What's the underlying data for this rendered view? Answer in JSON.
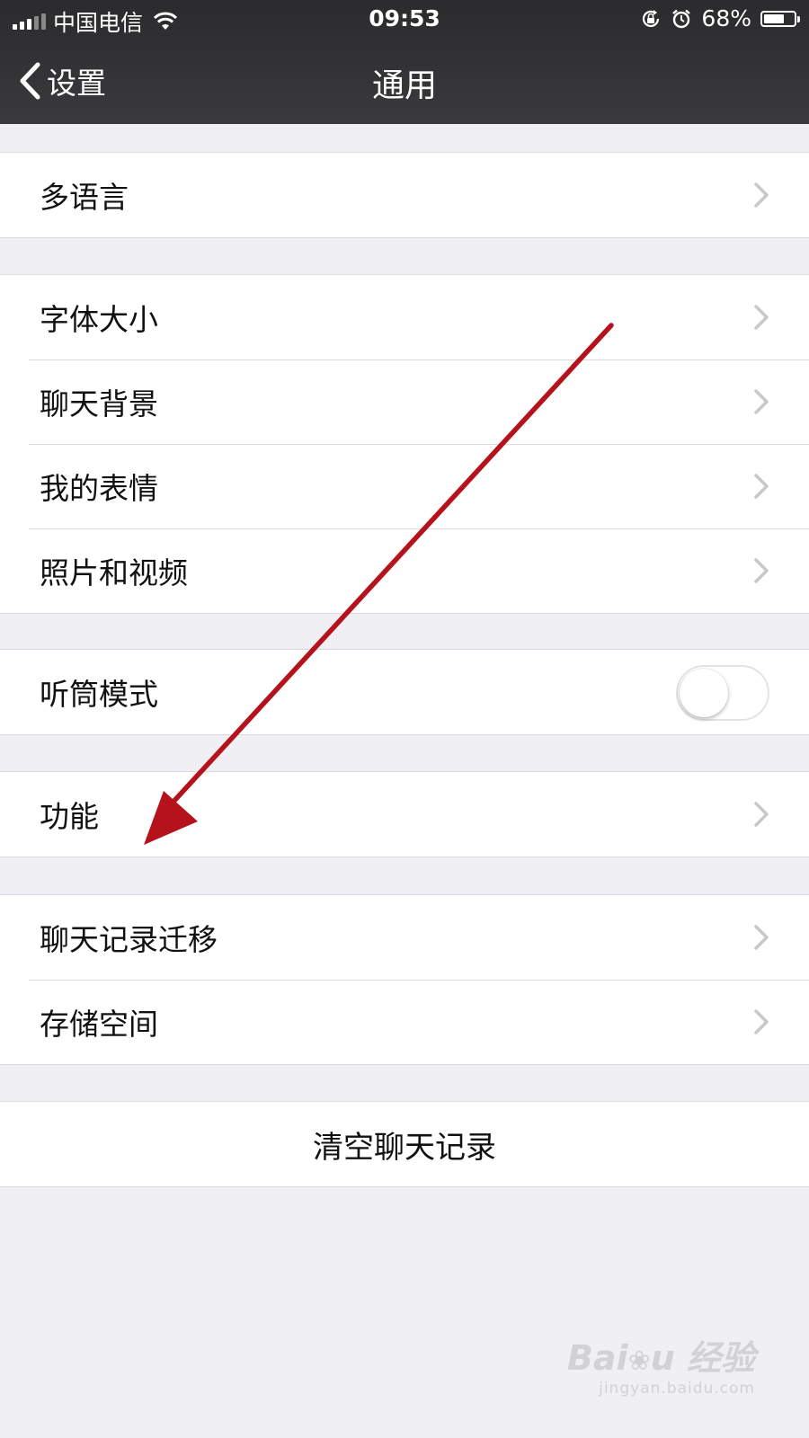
{
  "status_bar": {
    "carrier": "中国电信",
    "time": "09:53",
    "battery_percent": "68%",
    "battery_level": 0.68,
    "icons": [
      "signal-icon",
      "wifi-icon",
      "rotation-lock-icon",
      "alarm-icon",
      "battery-icon"
    ]
  },
  "nav": {
    "back_label": "设置",
    "title": "通用"
  },
  "groups": [
    {
      "rows": [
        {
          "label": "多语言",
          "accessory": "chevron"
        }
      ]
    },
    {
      "rows": [
        {
          "label": "字体大小",
          "accessory": "chevron"
        },
        {
          "label": "聊天背景",
          "accessory": "chevron"
        },
        {
          "label": "我的表情",
          "accessory": "chevron"
        },
        {
          "label": "照片和视频",
          "accessory": "chevron"
        }
      ]
    },
    {
      "rows": [
        {
          "label": "听筒模式",
          "accessory": "toggle",
          "toggle_on": false
        }
      ]
    },
    {
      "rows": [
        {
          "label": "功能",
          "accessory": "chevron"
        }
      ]
    },
    {
      "rows": [
        {
          "label": "聊天记录迁移",
          "accessory": "chevron"
        },
        {
          "label": "存储空间",
          "accessory": "chevron"
        }
      ]
    },
    {
      "rows": [
        {
          "label": "清空聊天记录",
          "accessory": "none"
        }
      ]
    }
  ],
  "annotation": {
    "arrow_color": "#b5121b"
  },
  "colors": {
    "background": "#efeff4",
    "navbar": "#333335"
  }
}
